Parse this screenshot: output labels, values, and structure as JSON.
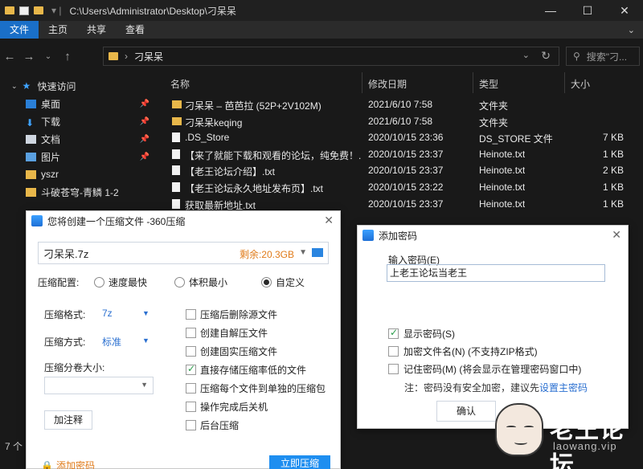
{
  "explorer": {
    "title_path": "C:\\Users\\Administrator\\Desktop\\刁呆呆",
    "ribbon_tabs": [
      "文件",
      "主页",
      "共享",
      "查看"
    ],
    "address_crumb": "刁呆呆",
    "search_placeholder": "搜索\"刁...",
    "columns": [
      "名称",
      "修改日期",
      "类型",
      "大小"
    ],
    "sidebar": [
      {
        "label": "快速访问",
        "icon": "star-icon",
        "pinned": false,
        "level": 0
      },
      {
        "label": "桌面",
        "icon": "desktop-icon",
        "pinned": true,
        "level": 1
      },
      {
        "label": "下载",
        "icon": "download-icon",
        "pinned": true,
        "level": 1
      },
      {
        "label": "文档",
        "icon": "document-icon",
        "pinned": true,
        "level": 1
      },
      {
        "label": "图片",
        "icon": "picture-icon",
        "pinned": true,
        "level": 1
      },
      {
        "label": "yszr",
        "icon": "folder-icon",
        "pinned": false,
        "level": 1
      },
      {
        "label": "斗破苍穹-青鳞 1-2",
        "icon": "folder-icon",
        "pinned": false,
        "level": 1
      }
    ],
    "files": [
      {
        "name": "刁呆呆 – 芭芭拉 (52P+2V102M)",
        "date": "2021/6/10 7:58",
        "type": "文件夹",
        "size": "",
        "icon": "folder"
      },
      {
        "name": "刁呆呆keqing",
        "date": "2021/6/10 7:58",
        "type": "文件夹",
        "size": "",
        "icon": "folder"
      },
      {
        "name": ".DS_Store",
        "date": "2020/10/15 23:36",
        "type": "DS_STORE 文件",
        "size": "7 KB",
        "icon": "blank"
      },
      {
        "name": "【来了就能下载和观看的论坛，纯免费！...",
        "date": "2020/10/15 23:37",
        "type": "Heinote.txt",
        "size": "1 KB",
        "icon": "doc"
      },
      {
        "name": "【老王论坛介绍】.txt",
        "date": "2020/10/15 23:37",
        "type": "Heinote.txt",
        "size": "2 KB",
        "icon": "doc"
      },
      {
        "name": "【老王论坛永久地址发布页】.txt",
        "date": "2020/10/15 23:22",
        "type": "Heinote.txt",
        "size": "1 KB",
        "icon": "doc"
      },
      {
        "name": "获取最新地址.txt",
        "date": "2020/10/15 23:37",
        "type": "Heinote.txt",
        "size": "1 KB",
        "icon": "doc"
      }
    ],
    "status": "7 个"
  },
  "compress_dialog": {
    "title": "您将创建一个压缩文件 -360压缩",
    "filename": "刁呆呆.7z",
    "free_space": "剩余:20.3GB",
    "config_label": "压缩配置:",
    "modes": [
      "速度最快",
      "体积最小",
      "自定义"
    ],
    "selected_mode": "自定义",
    "format_label": "压缩格式:",
    "format_value": "7z",
    "method_label": "压缩方式:",
    "method_value": "标准",
    "split_label": "压缩分卷大小:",
    "add_comment": "加注释",
    "options": [
      {
        "label": "压缩后删除源文件",
        "checked": false
      },
      {
        "label": "创建自解压文件",
        "checked": false
      },
      {
        "label": "创建固实压缩文件",
        "checked": false
      },
      {
        "label": "直接存储压缩率低的文件",
        "checked": true
      },
      {
        "label": "压缩每个文件到单独的压缩包",
        "checked": false
      },
      {
        "label": "操作完成后关机",
        "checked": false
      },
      {
        "label": "后台压缩",
        "checked": false
      }
    ],
    "add_password": "添加密码",
    "start_button": "立即压缩"
  },
  "password_dialog": {
    "title": "添加密码",
    "input_label": "输入密码(E)",
    "input_value": "上老王论坛当老王",
    "checkboxes": [
      {
        "label": "显示密码(S)",
        "checked": true
      },
      {
        "label": "加密文件名(N) (不支持ZIP格式)",
        "checked": false
      },
      {
        "label": "记住密码(M) (将会显示在管理密码窗口中)",
        "checked": false
      }
    ],
    "note_text": "注：密码没有安全加密，建议先",
    "note_link": "设置主密码",
    "ok_button": "确认"
  },
  "watermark": {
    "title": "老王论坛",
    "sub": "laowang.vip"
  }
}
